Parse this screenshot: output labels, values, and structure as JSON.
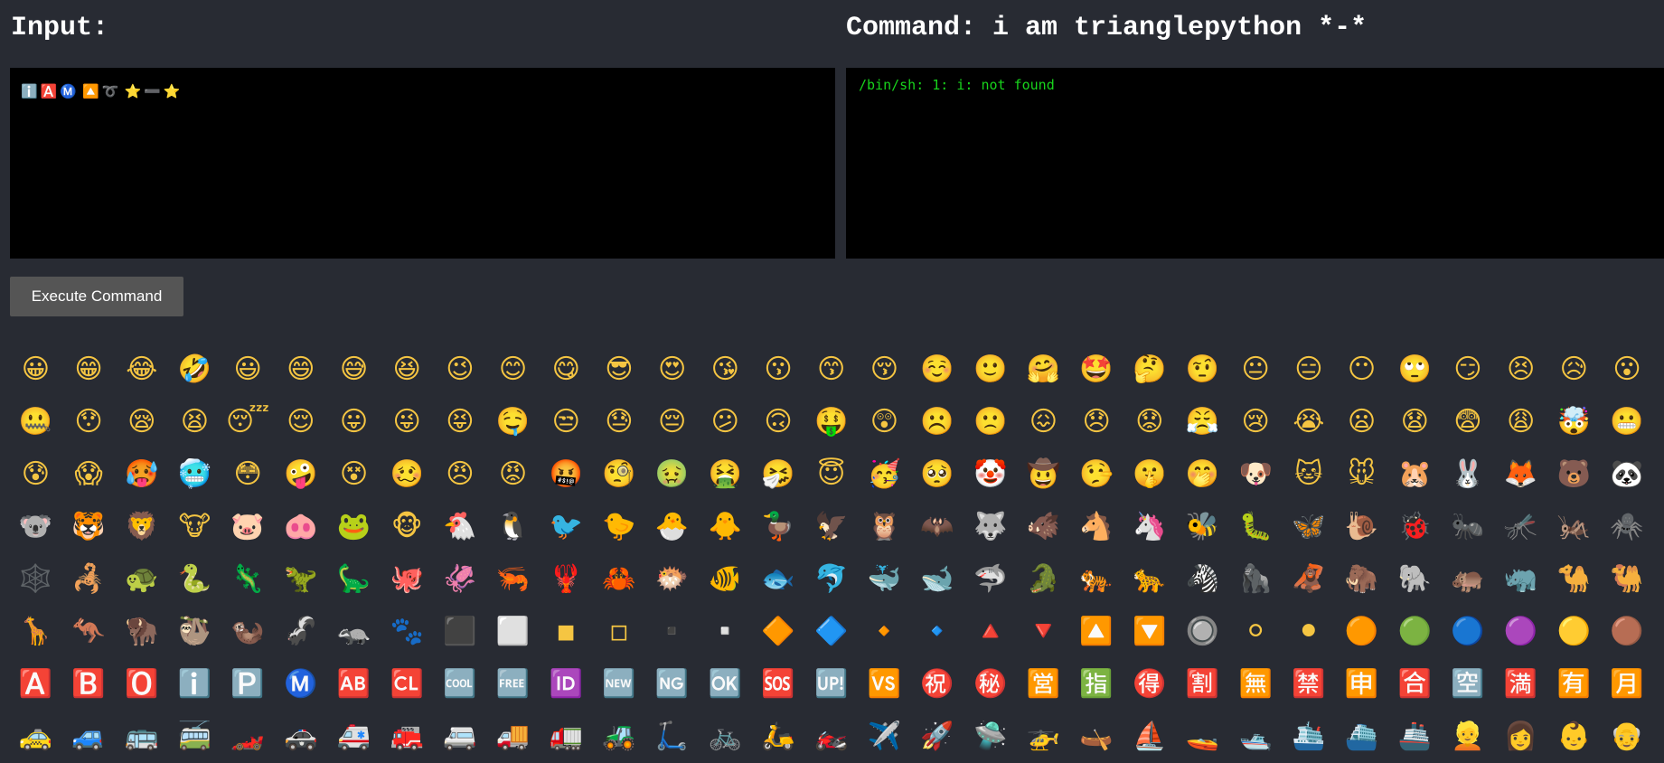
{
  "input_heading": "Input:",
  "command_heading": "Command: i am trianglepython *-*",
  "input_emojis": [
    "ℹ️",
    "🅰️",
    "Ⓜ️",
    " ",
    "🔼",
    "➰",
    " ",
    "⭐",
    "➖",
    "⭐"
  ],
  "output_text": "/bin/sh: 1: i: not found",
  "execute_label": "Execute Command",
  "emoji_rows": [
    [
      "😀",
      "😁",
      "😂",
      "🤣",
      "😃",
      "😄",
      "😅",
      "😆",
      "😉",
      "😊",
      "😋",
      "😎",
      "😍",
      "😘",
      "😗",
      "😙",
      "😚",
      "☺️",
      "🙂",
      "🤗",
      "🤩",
      "🤔",
      "🤨",
      "😐",
      "😑",
      "😶",
      "🙄",
      "😏",
      "😣",
      "😥",
      "😮"
    ],
    [
      "🤐",
      "😯",
      "😪",
      "😫",
      "😴",
      "😌",
      "😛",
      "😜",
      "😝",
      "🤤",
      "😒",
      "😓",
      "😔",
      "😕",
      "🙃",
      "🤑",
      "😲",
      "☹️",
      "🙁",
      "😖",
      "😞",
      "😟",
      "😤",
      "😢",
      "😭",
      "😦",
      "😧",
      "😨",
      "😩",
      "🤯",
      "😬"
    ],
    [
      "😰",
      "😱",
      "🥵",
      "🥶",
      "😳",
      "🤪",
      "😵",
      "🥴",
      "😠",
      "😡",
      "🤬",
      "🧐",
      "🤢",
      "🤮",
      "🤧",
      "😇",
      "🥳",
      "🥺",
      "🤡",
      "🤠",
      "🤥",
      "🤫",
      "🤭",
      "🐶",
      "🐱",
      "🐭",
      "🐹",
      "🐰",
      "🦊",
      "🐻",
      "🐼"
    ],
    [
      "🐨",
      "🐯",
      "🦁",
      "🐮",
      "🐷",
      "🐽",
      "🐸",
      "🐵",
      "🐔",
      "🐧",
      "🐦",
      "🐤",
      "🐣",
      "🐥",
      "🦆",
      "🦅",
      "🦉",
      "🦇",
      "🐺",
      "🐗",
      "🐴",
      "🦄",
      "🐝",
      "🐛",
      "🦋",
      "🐌",
      "🐞",
      "🐜",
      "🦟",
      "🦗",
      "🕷️"
    ],
    [
      "🕸️",
      "🦂",
      "🐢",
      "🐍",
      "🦎",
      "🦖",
      "🦕",
      "🐙",
      "🦑",
      "🦐",
      "🦞",
      "🦀",
      "🐡",
      "🐠",
      "🐟",
      "🐬",
      "🐳",
      "🐋",
      "🦈",
      "🐊",
      "🐅",
      "🐆",
      "🦓",
      "🦍",
      "🦧",
      "🦣",
      "🐘",
      "🦛",
      "🦏",
      "🐪",
      "🐫"
    ],
    [
      "🦒",
      "🦘",
      "🦬",
      "🦥",
      "🦦",
      "🦨",
      "🦡",
      "🐾",
      "⬛",
      "⬜",
      "◾",
      "◽",
      "▪️",
      "▫️",
      "🔶",
      "🔷",
      "🔸",
      "🔹",
      "🔺",
      "🔻",
      "🔼",
      "🔽",
      "🔘",
      "⚪",
      "⚫",
      "🟠",
      "🟢",
      "🔵",
      "🟣",
      "🟡",
      "🟤",
      "⭕"
    ],
    [
      "🅰️",
      "🅱️",
      "🅾️",
      "ℹ️",
      "🅿️",
      "Ⓜ️",
      "🆎",
      "🆑",
      "🆒",
      "🆓",
      "🆔",
      "🆕",
      "🆖",
      "🆗",
      "🆘",
      "🆙",
      "🆚",
      "㊗️",
      "㊙️",
      "🈺",
      "🈯",
      "🉐",
      "🈹",
      "🈚",
      "🈲",
      "🈸",
      "🈴",
      "🈳",
      "🈵",
      "🈶",
      "🈷️",
      "🚗"
    ],
    [
      "🚕",
      "🚙",
      "🚌",
      "🚎",
      "🏎️",
      "🚓",
      "🚑",
      "🚒",
      "🚐",
      "🚚",
      "🚛",
      "🚜",
      "🛴",
      "🚲",
      "🛵",
      "🏍️",
      "✈️",
      "🚀",
      "🛸",
      "🚁",
      "🛶",
      "⛵",
      "🚤",
      "🛥️",
      "🛳️",
      "⛴️",
      "🚢",
      "👱",
      "👩",
      "👶",
      "👴"
    ]
  ]
}
